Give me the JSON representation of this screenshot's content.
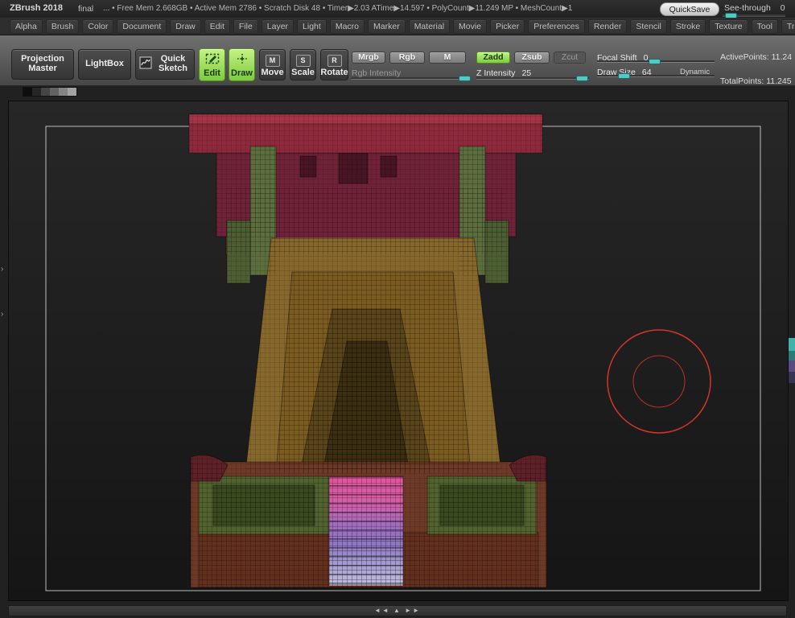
{
  "title_bar": {
    "app_title": "ZBrush 2018",
    "document_name": "final",
    "stats": "... • Free Mem 2.668GB • Active Mem 2786 • Scratch Disk 48 • Timer▶2.03 ATime▶14.597 • PolyCount▶11.249 MP • MeshCount▶1",
    "quicksave_label": "QuickSave",
    "seethrough_label": "See-through",
    "seethrough_value": "0"
  },
  "menu_bar": {
    "items": [
      "Alpha",
      "Brush",
      "Color",
      "Document",
      "Draw",
      "Edit",
      "File",
      "Layer",
      "Light",
      "Macro",
      "Marker",
      "Material",
      "Movie",
      "Picker",
      "Preferences",
      "Render",
      "Stencil",
      "Stroke",
      "Texture",
      "Tool",
      "Transform"
    ]
  },
  "toolbar": {
    "projection_master_label": "Projection Master",
    "lightbox_label": "LightBox",
    "quick_sketch_label": "Quick Sketch",
    "edit_label": "Edit",
    "draw_label": "Draw",
    "move_label": "Move",
    "scale_label": "Scale",
    "rotate_label": "Rotate",
    "move_letter": "M",
    "scale_letter": "S",
    "rotate_letter": "R",
    "mrgb_label": "Mrgb",
    "rgb_label": "Rgb",
    "m_label": "M",
    "rgb_intensity_label": "Rgb Intensity",
    "zadd_label": "Zadd",
    "zsub_label": "Zsub",
    "zcut_label": "Zcut",
    "z_intensity_label": "Z Intensity",
    "z_intensity_value": "25",
    "focal_shift_label": "Focal Shift",
    "focal_shift_value": "0",
    "draw_size_label": "Draw Size",
    "draw_size_value": "64",
    "dynamic_label": "Dynamic",
    "active_points": "ActivePoints: 11.24",
    "total_points": "TotalPoints: 11.245"
  },
  "icons": {
    "left_tray_arrow_top": "›",
    "left_tray_arrow_bottom": "›",
    "dock_arrows": "◄◄ ▲ ►►"
  },
  "colors": {
    "active_green": "#8ecb3d",
    "slider_teal": "#54c8c5",
    "cursor_red": "#d2352a"
  }
}
